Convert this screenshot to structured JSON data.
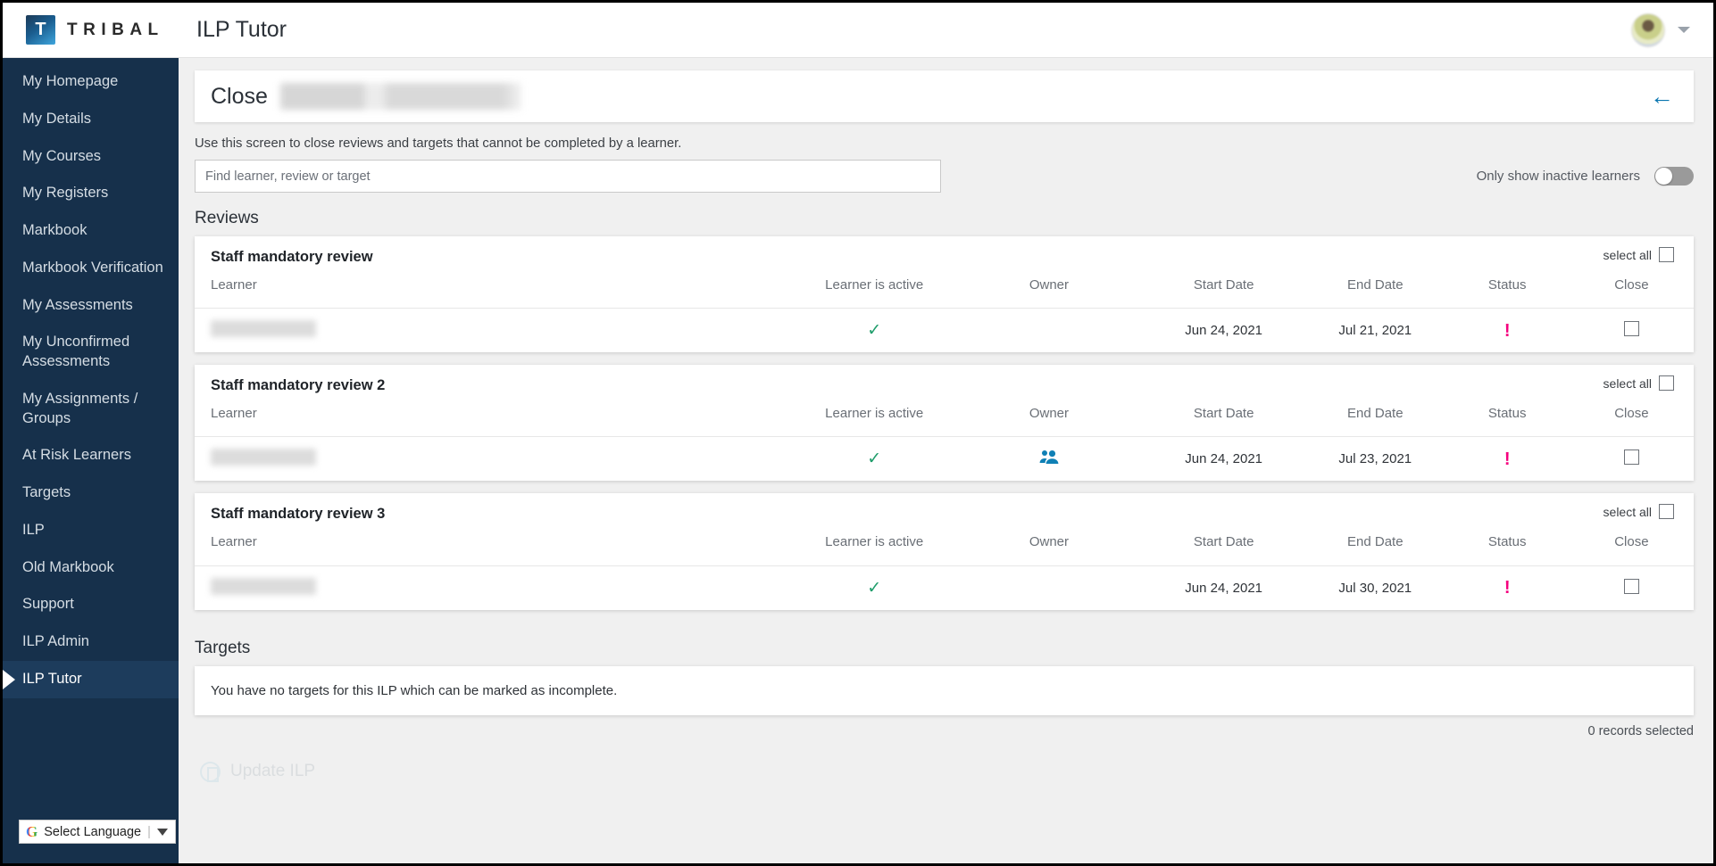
{
  "app": {
    "brand_letter": "T",
    "brand_name": "TRIBAL",
    "page_title": "ILP Tutor"
  },
  "sidebar": {
    "items": [
      {
        "label": "My Homepage",
        "active": false
      },
      {
        "label": "My Details",
        "active": false
      },
      {
        "label": "My Courses",
        "active": false
      },
      {
        "label": "My Registers",
        "active": false
      },
      {
        "label": "Markbook",
        "active": false
      },
      {
        "label": "Markbook Verification",
        "active": false
      },
      {
        "label": "My Assessments",
        "active": false
      },
      {
        "label": "My Unconfirmed Assessments",
        "active": false
      },
      {
        "label": "My Assignments / Groups",
        "active": false
      },
      {
        "label": "At Risk Learners",
        "active": false
      },
      {
        "label": "Targets",
        "active": false
      },
      {
        "label": "ILP",
        "active": false
      },
      {
        "label": "Old Markbook",
        "active": false
      },
      {
        "label": "Support",
        "active": false
      },
      {
        "label": "ILP Admin",
        "active": false
      },
      {
        "label": "ILP Tutor",
        "active": true
      }
    ],
    "language_widget": {
      "google_letter": "G",
      "label": "Select Language",
      "separator": "|",
      "caret": "chevron-down-icon"
    }
  },
  "panel": {
    "title": "Close",
    "learner_name_redacted": "",
    "back_icon": "←",
    "helper_text": "Use this screen to close reviews and targets that cannot be completed by a learner."
  },
  "search": {
    "value": "",
    "placeholder": "Find learner, review or target"
  },
  "inactive_toggle": {
    "label": "Only show inactive learners",
    "state": "off"
  },
  "sections": {
    "reviews_title": "Reviews",
    "targets_title": "Targets"
  },
  "table_headers": {
    "learner": "Learner",
    "learner_active": "Learner is active",
    "owner": "Owner",
    "start_date": "Start Date",
    "end_date": "End Date",
    "status": "Status",
    "close": "Close",
    "select_all": "select all"
  },
  "reviews": [
    {
      "title": "Staff mandatory review",
      "rows": [
        {
          "learner": "",
          "learner_active": true,
          "owner_icon": "",
          "start_date": "Jun 24, 2021",
          "end_date": "Jul 21, 2021",
          "status": "!",
          "close_checked": false
        }
      ]
    },
    {
      "title": "Staff mandatory review 2",
      "rows": [
        {
          "learner": "",
          "learner_active": true,
          "owner_icon": "people-icon",
          "start_date": "Jun 24, 2021",
          "end_date": "Jul 23, 2021",
          "status": "!",
          "close_checked": false
        }
      ]
    },
    {
      "title": "Staff mandatory review 3",
      "rows": [
        {
          "learner": "",
          "learner_active": true,
          "owner_icon": "",
          "start_date": "Jun 24, 2021",
          "end_date": "Jul 30, 2021",
          "status": "!",
          "close_checked": false
        }
      ]
    }
  ],
  "targets": {
    "empty_message": "You have no targets for this ILP which can be marked as incomplete."
  },
  "footer": {
    "records_selected": "0 records selected",
    "update_button": "Update ILP"
  },
  "colors": {
    "sidebar_bg": "#16304b",
    "status_pink": "#F5007E",
    "check_green": "#1f9d6b",
    "link_blue": "#0a76b0",
    "owner_blue": "#0f80b5"
  }
}
